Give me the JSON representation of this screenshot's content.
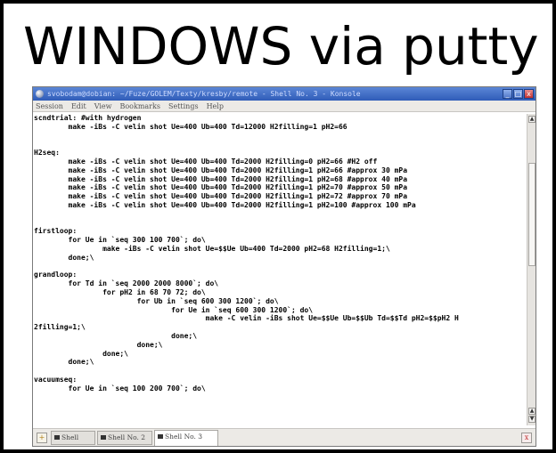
{
  "slide": {
    "title": "WINDOWS via putty"
  },
  "window": {
    "title": "svobodam@dobian: ~/Fuze/GOLEM/Texty/kresby/remote - Shell No. 3 - Konsole",
    "buttons": {
      "minimize": "_",
      "maximize": "□",
      "close": "x"
    }
  },
  "menu": {
    "items": [
      "Session",
      "Edit",
      "View",
      "Bookmarks",
      "Settings",
      "Help"
    ]
  },
  "terminal": {
    "lines": [
      "scndtrial: #with hydrogen",
      "        make -iBs -C velin shot Ue=400 Ub=400 Td=12000 H2filling=1 pH2=66",
      "",
      "",
      "H2seq:",
      "        make -iBs -C velin shot Ue=400 Ub=400 Td=2000 H2filling=0 pH2=66 #H2 off",
      "        make -iBs -C velin shot Ue=400 Ub=400 Td=2000 H2filling=1 pH2=66 #approx 30 mPa",
      "        make -iBs -C velin shot Ue=400 Ub=400 Td=2000 H2filling=1 pH2=68 #approx 40 mPa",
      "        make -iBs -C velin shot Ue=400 Ub=400 Td=2000 H2filling=1 pH2=70 #approx 50 mPa",
      "        make -iBs -C velin shot Ue=400 Ub=400 Td=2000 H2filling=1 pH2=72 #approx 70 mPa",
      "        make -iBs -C velin shot Ue=400 Ub=400 Td=2000 H2filling=1 pH2=100 #approx 100 mPa",
      "",
      "",
      "firstloop:",
      "        for Ue in `seq 300 100 700`; do\\",
      "                make -iBs -C velin shot Ue=$$Ue Ub=400 Td=2000 pH2=68 H2filling=1;\\",
      "        done;\\",
      "",
      "grandloop:",
      "        for Td in `seq 2000 2000 8000`; do\\",
      "                for pH2 in 68 70 72; do\\",
      "                        for Ub in `seq 600 300 1200`; do\\",
      "                                for Ue in `seq 600 300 1200`; do\\",
      "                                        make -C velin -iBs shot Ue=$$Ue Ub=$$Ub Td=$$Td pH2=$$pH2 H",
      "2filling=1;\\",
      "                                done;\\",
      "                        done;\\",
      "                done;\\",
      "        done;\\",
      "",
      "vacuumseq:",
      "        for Ue in `seq 100 200 700`; do\\"
    ]
  },
  "tabs": [
    {
      "label": "Shell"
    },
    {
      "label": "Shell No. 2"
    },
    {
      "label": "Shell No. 3"
    }
  ],
  "icons": {
    "new_tab": "new-tab-icon",
    "close_tab": "close-tab-icon",
    "terminal": "terminal-icon"
  },
  "colors": {
    "titlebar": "#2f5cb8",
    "chrome": "#eceae6",
    "terminal_bg": "#ffffff",
    "terminal_fg": "#000000"
  }
}
